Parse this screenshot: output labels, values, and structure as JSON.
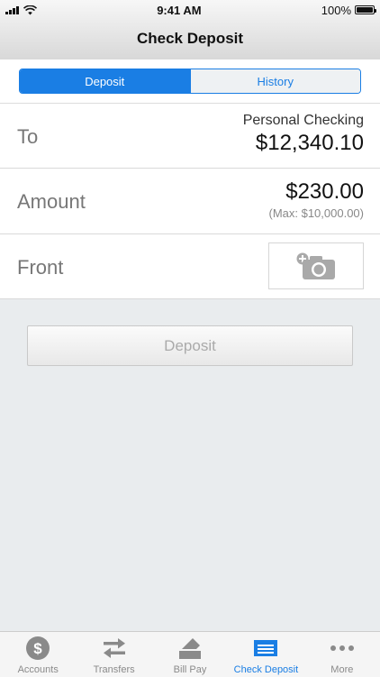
{
  "status_bar": {
    "time": "9:41 AM",
    "battery": "100%"
  },
  "nav": {
    "title": "Check Deposit"
  },
  "segments": [
    {
      "label": "Deposit",
      "active": true
    },
    {
      "label": "History",
      "active": false
    }
  ],
  "to_row": {
    "label": "To",
    "account_name": "Personal Checking",
    "balance": "$12,340.10"
  },
  "amount_row": {
    "label": "Amount",
    "value": "$230.00",
    "max": "(Max: $10,000.00)"
  },
  "front_row": {
    "label": "Front",
    "icon": "camera-add-icon"
  },
  "deposit_button": {
    "label": "Deposit"
  },
  "tabs": [
    {
      "label": "Accounts",
      "icon": "dollar-circle-icon"
    },
    {
      "label": "Transfers",
      "icon": "transfer-arrows-icon"
    },
    {
      "label": "Bill Pay",
      "icon": "bill-pay-icon"
    },
    {
      "label": "Check Deposit",
      "icon": "check-deposit-icon",
      "active": true
    },
    {
      "label": "More",
      "icon": "more-dots-icon"
    }
  ],
  "colors": {
    "accent": "#1a7ee4",
    "tab_inactive": "#8a8a8a"
  }
}
